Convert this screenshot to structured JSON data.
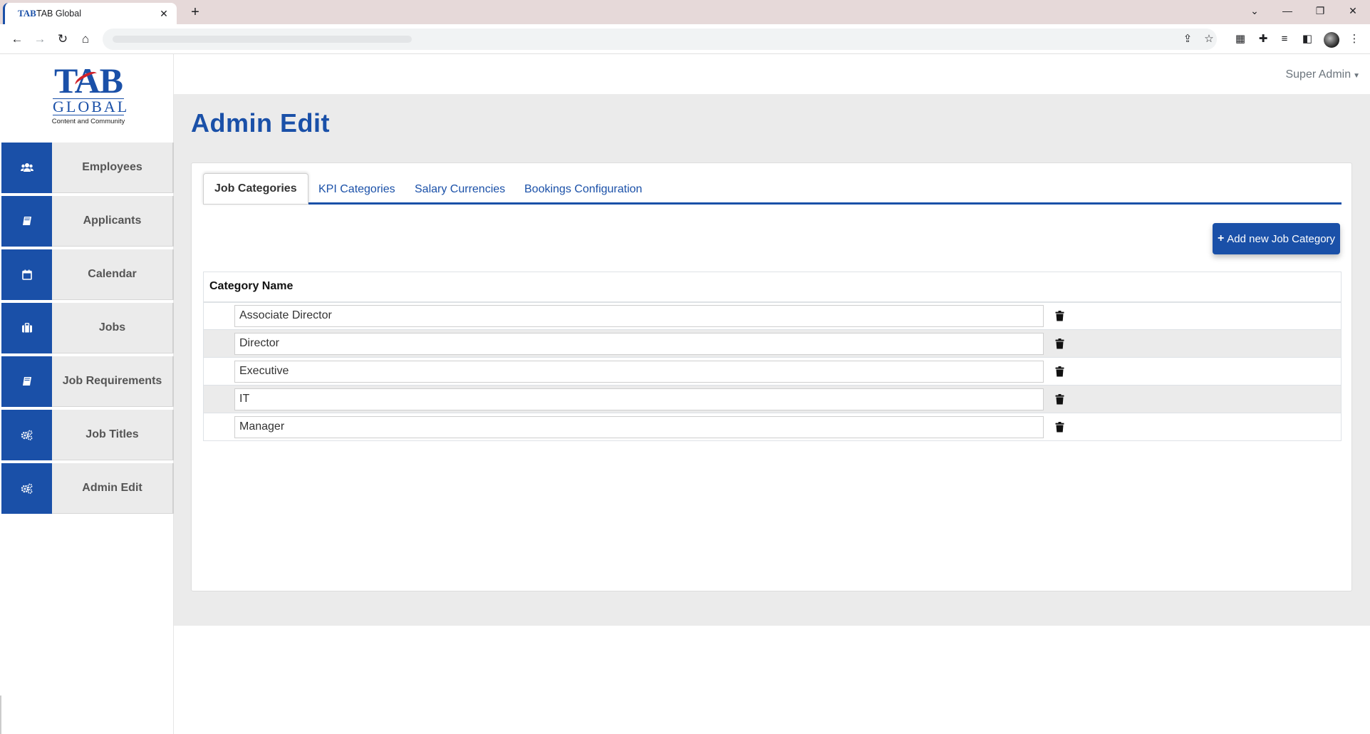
{
  "browser": {
    "tab_title": "TAB Global",
    "tab_favicon": "TAB",
    "new_tab_symbol": "+",
    "close_symbol": "✕"
  },
  "logo": {
    "brand": "TAB",
    "global": "GLOBAL",
    "tagline": "Content and Community"
  },
  "sidebar": {
    "items": [
      {
        "label": "Employees",
        "icon": "users-icon"
      },
      {
        "label": "Applicants",
        "icon": "book-icon"
      },
      {
        "label": "Calendar",
        "icon": "calendar-icon"
      },
      {
        "label": "Jobs",
        "icon": "briefcase-icon"
      },
      {
        "label": "Job Requirements",
        "icon": "book-icon"
      },
      {
        "label": "Job Titles",
        "icon": "cogs-icon"
      },
      {
        "label": "Admin Edit",
        "icon": "cogs-icon"
      }
    ]
  },
  "header": {
    "user_menu": "Super Admin"
  },
  "page": {
    "title": "Admin Edit"
  },
  "tabs": [
    {
      "label": "Job Categories",
      "active": true
    },
    {
      "label": "KPI Categories",
      "active": false
    },
    {
      "label": "Salary Currencies",
      "active": false
    },
    {
      "label": "Bookings Configuration",
      "active": false
    }
  ],
  "actions": {
    "add_button": "Add new Job Category"
  },
  "table": {
    "column_header": "Category Name",
    "rows": [
      {
        "value": "Associate Director"
      },
      {
        "value": "Director"
      },
      {
        "value": "Executive"
      },
      {
        "value": "IT"
      },
      {
        "value": "Manager"
      }
    ]
  },
  "colors": {
    "brand_blue": "#1a50a8",
    "sidebar_bg": "#ebebeb",
    "accent_red": "#d0222a"
  }
}
